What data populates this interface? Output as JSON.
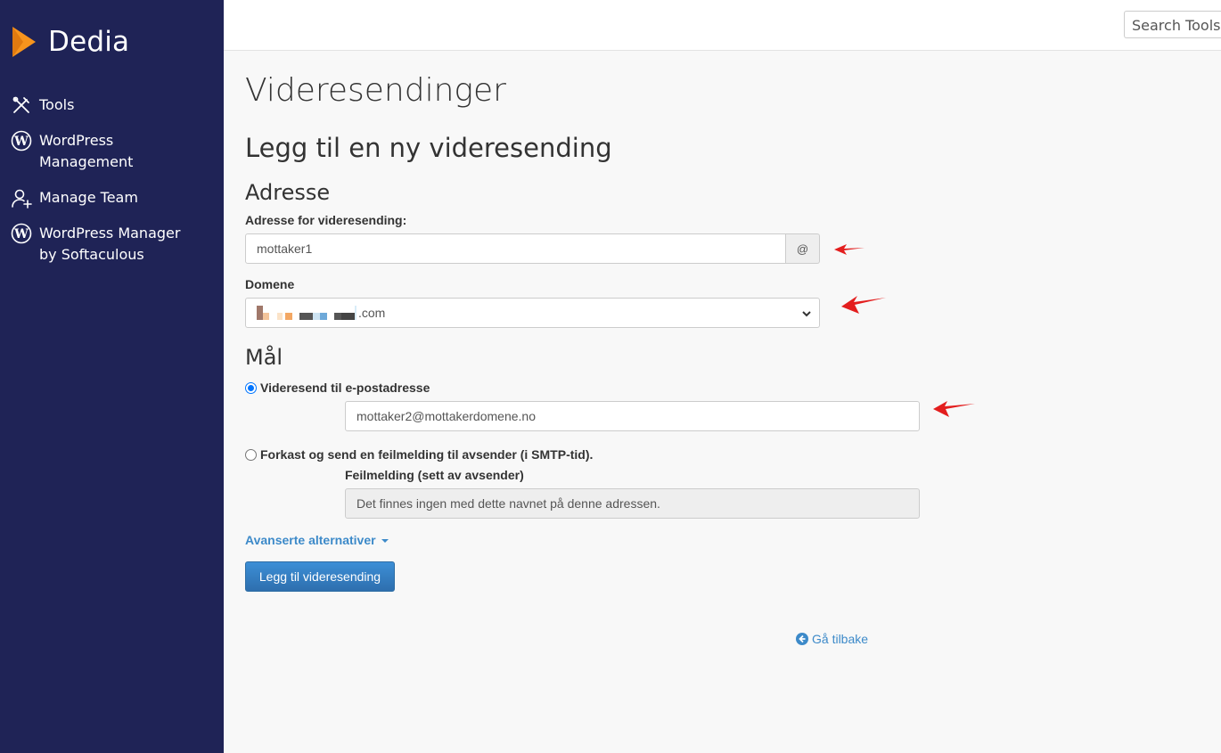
{
  "sidebar": {
    "brand": "Dedia",
    "items": [
      {
        "label": "Tools",
        "icon": "tools-icon"
      },
      {
        "label": "WordPress Management",
        "icon": "wordpress-icon"
      },
      {
        "label": "Manage Team",
        "icon": "add-user-icon"
      },
      {
        "label": "WordPress Manager by Softaculous",
        "icon": "wordpress-icon"
      }
    ]
  },
  "topbar": {
    "search_placeholder": "Search Tools ("
  },
  "main": {
    "page_title": "Videresendinger",
    "section_title": "Legg til en ny videresending",
    "address_heading": "Adresse",
    "address_label": "Adresse for videresending:",
    "address_value": "mottaker1",
    "at_sign": "@",
    "domain_label": "Domene",
    "domain_value": ".com",
    "target_heading": "Mål",
    "option_forward_label": "Videresend til e-postadresse",
    "forward_email_value": "mottaker2@mottakerdomene.no",
    "option_discard_label": "Forkast og send en feilmelding til avsender (i SMTP-tid).",
    "error_message_label": "Feilmelding (sett av avsender)",
    "error_message_value": "Det finnes ingen med dette navnet på denne adressen.",
    "advanced_link": "Avanserte alternativer",
    "submit_button": "Legg til videresending",
    "back_link": "Gå tilbake"
  },
  "colors": {
    "sidebar_bg": "#1f2356",
    "brand_orange": "#f7941d",
    "primary_button": "#337ab7",
    "link": "#3d8ac9",
    "annotation_arrow": "#e31e1e"
  }
}
